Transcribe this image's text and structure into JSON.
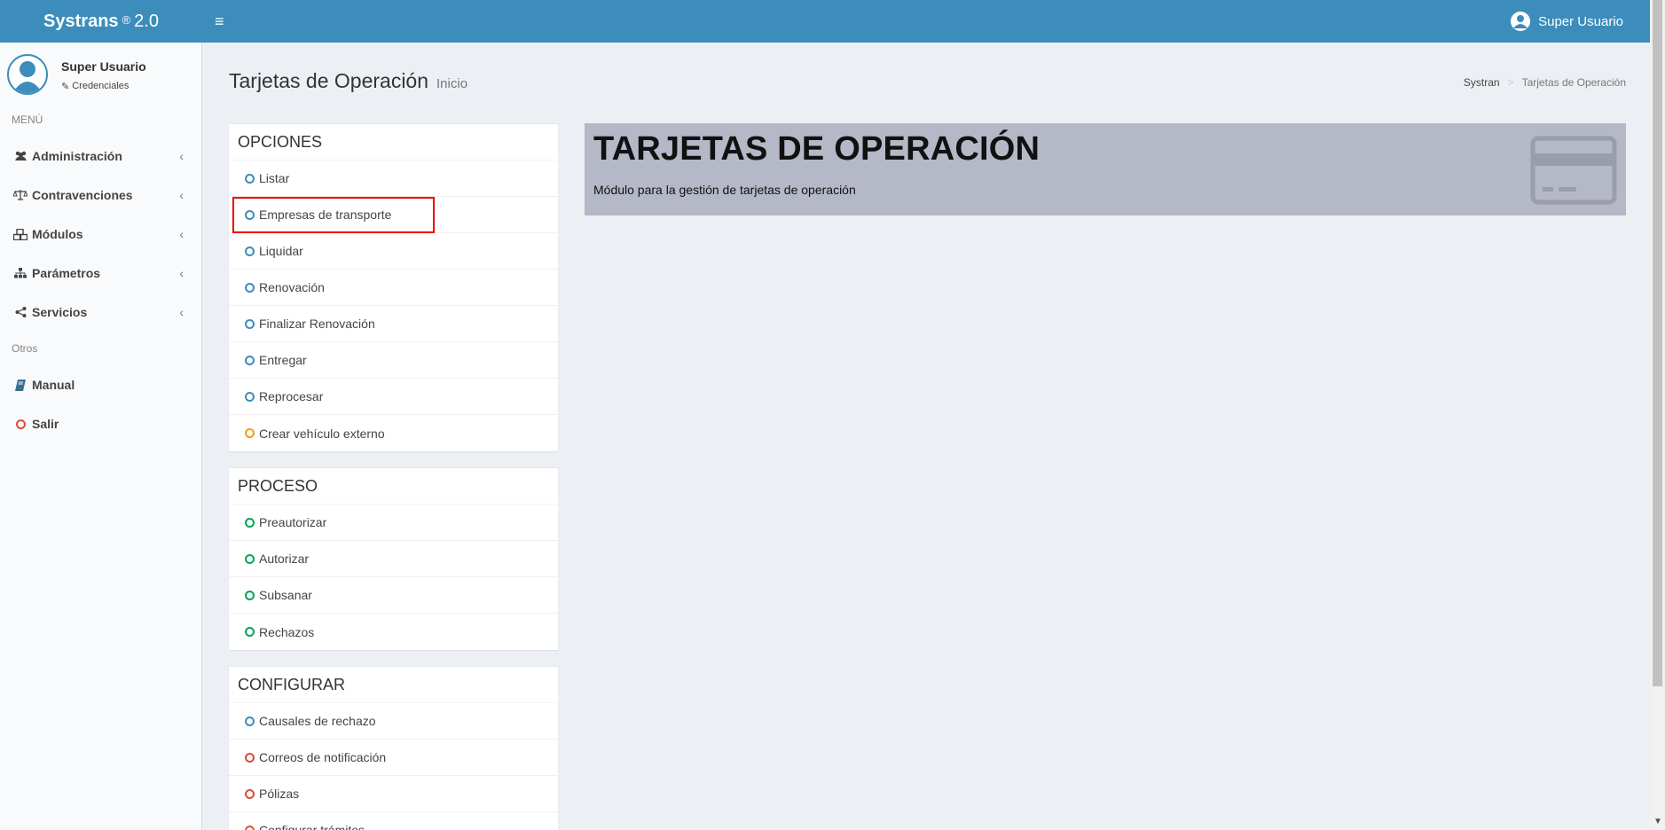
{
  "header": {
    "brand_bold": "Systrans",
    "brand_reg": "®",
    "brand_version": "2.0",
    "user_name": "Super Usuario"
  },
  "sidebar": {
    "user_name": "Super Usuario",
    "credentials_label": "Credenciales",
    "menu_header": "MENÚ",
    "items": [
      {
        "label": "Administración",
        "icon": "users-icon"
      },
      {
        "label": "Contravenciones",
        "icon": "balance-scale-icon"
      },
      {
        "label": "Módulos",
        "icon": "cubes-icon"
      },
      {
        "label": "Parámetros",
        "icon": "sitemap-icon"
      },
      {
        "label": "Servicios",
        "icon": "share-icon"
      }
    ],
    "other_header": "Otros",
    "other_items": [
      {
        "label": "Manual",
        "icon": "book-icon"
      },
      {
        "label": "Salir",
        "icon": "circle-icon"
      }
    ]
  },
  "content": {
    "title": "Tarjetas de Operación",
    "subtitle": "Inicio",
    "breadcrumb": {
      "root": "Systran",
      "sep": ">",
      "current": "Tarjetas de Operación"
    }
  },
  "boxes": {
    "opciones": {
      "title": "OPCIONES",
      "items": [
        "Listar",
        "Empresas de transporte",
        "Liquidar",
        "Renovación",
        "Finalizar Renovación",
        "Entregar",
        "Reprocesar",
        "Crear vehículo externo"
      ]
    },
    "proceso": {
      "title": "PROCESO",
      "items": [
        "Preautorizar",
        "Autorizar",
        "Subsanar",
        "Rechazos"
      ]
    },
    "configurar": {
      "title": "CONFIGURAR",
      "items": [
        "Causales de rechazo",
        "Correos de notificación",
        "Pólizas",
        "Configurar trámites"
      ]
    }
  },
  "callout": {
    "title": "TARJETAS DE OPERACIÓN",
    "text": "Módulo para la gestión de tarjetas de operación"
  },
  "colors": {
    "header_bg": "#3c8dbc",
    "callout_bg": "#b5b8c7",
    "blue": "#3c8dbc",
    "orange": "#f39c12",
    "green": "#00a65a",
    "red": "#dd4b39"
  }
}
